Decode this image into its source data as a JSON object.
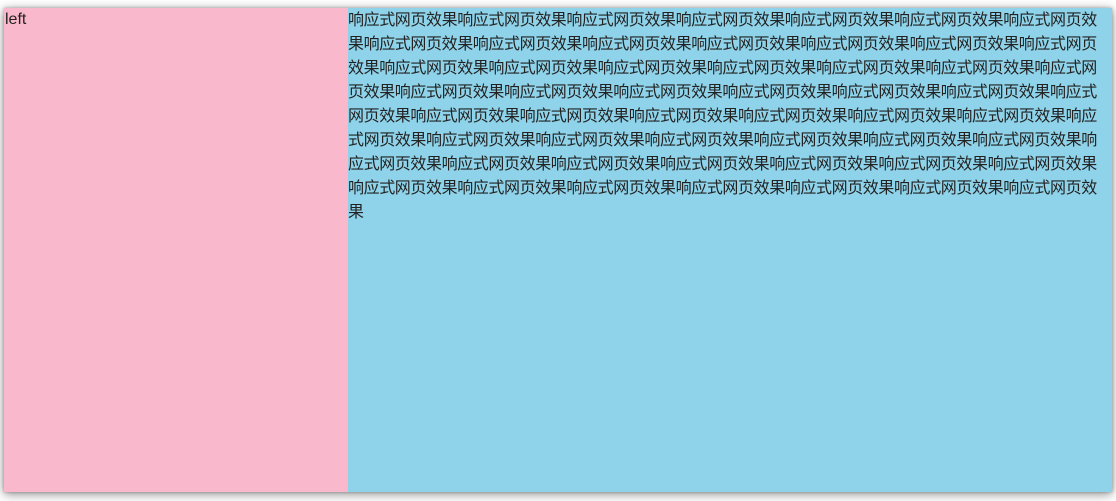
{
  "left_panel": {
    "label": "left",
    "background": "#f9b8cb"
  },
  "right_panel": {
    "text": "响应式网页效果响应式网页效果响应式网页效果响应式网页效果响应式网页效果响应式网页效果响应式网页效果响应式网页效果响应式网页效果响应式网页效果响应式网页效果响应式网页效果响应式网页效果响应式网页效果响应式网页效果响应式网页效果响应式网页效果响应式网页效果响应式网页效果响应式网页效果响应式网页效果响应式网页效果响应式网页效果响应式网页效果响应式网页效果响应式网页效果响应式网页效果响应式网页效果响应式网页效果响应式网页效果响应式网页效果响应式网页效果响应式网页效果响应式网页效果响应式网页效果响应式网页效果响应式网页效果响应式网页效果响应式网页效果响应式网页效果响应式网页效果响应式网页效果响应式网页效果响应式网页效果响应式网页效果响应式网页效果响应式网页效果响应式网页效果响应式网页效果响应式网页效果响应式网页效果响应式网页效果响应式网页效果响应式网页效果响应式网页效果",
    "background": "#8fd3ea"
  }
}
